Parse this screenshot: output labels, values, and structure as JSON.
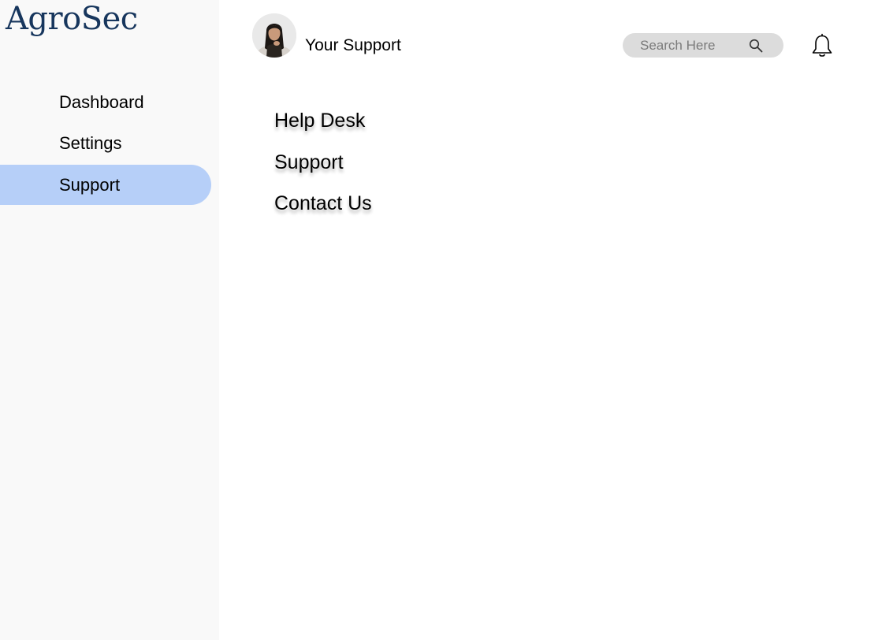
{
  "app": {
    "logo": "AgroSec"
  },
  "sidebar": {
    "items": [
      {
        "label": "Dashboard",
        "active": false
      },
      {
        "label": "Settings",
        "active": false
      },
      {
        "label": "Support",
        "active": true
      }
    ],
    "active_color": "#b6cff8"
  },
  "header": {
    "title": "Your Support",
    "search": {
      "placeholder": "Search Here",
      "value": ""
    },
    "icons": [
      "search-icon",
      "bell-icon"
    ]
  },
  "main": {
    "menu": [
      {
        "label": "Help Desk"
      },
      {
        "label": "Support"
      },
      {
        "label": "Contact Us"
      }
    ]
  },
  "colors": {
    "logo": "#17365d",
    "sidebar_bg": "#f9f9f9",
    "search_bg": "#dcdcdc"
  }
}
